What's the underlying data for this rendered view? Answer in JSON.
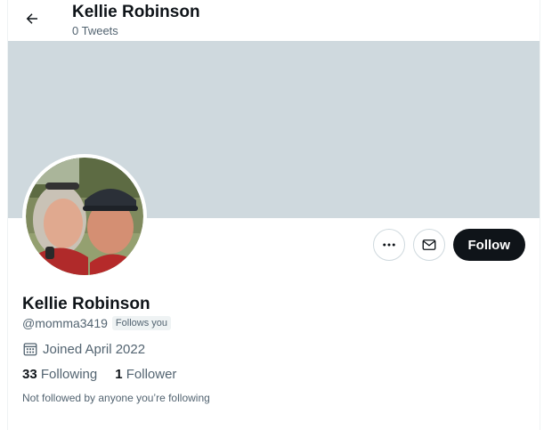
{
  "header": {
    "name": "Kellie Robinson",
    "tweets": "0 Tweets",
    "back_icon": "arrow-left-icon"
  },
  "profile": {
    "name": "Kellie Robinson",
    "handle": "@momma3419",
    "follows_you": "Follows you",
    "joined": "Joined April 2022",
    "following_count": "33",
    "following_label": "Following",
    "followers_count": "1",
    "followers_label": "Follower",
    "not_followed_text": "Not followed by anyone you’re following"
  },
  "actions": {
    "more_icon": "more-dots-icon",
    "message_icon": "envelope-icon",
    "follow_label": "Follow"
  },
  "colors": {
    "banner": "#cfd9de",
    "primary_text": "#0f1419",
    "secondary_text": "#536471",
    "follow_button": "#0f1419"
  }
}
